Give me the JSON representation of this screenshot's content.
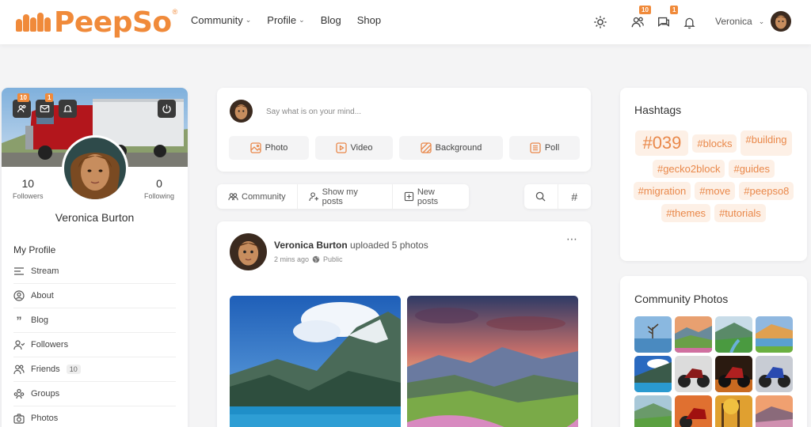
{
  "brand": {
    "name": "PeepSo",
    "reg": "®",
    "color": "#f08a3a"
  },
  "nav": [
    {
      "label": "Community",
      "chevron": true
    },
    {
      "label": "Profile",
      "chevron": true
    },
    {
      "label": "Blog",
      "chevron": false
    },
    {
      "label": "Shop",
      "chevron": false
    }
  ],
  "header": {
    "friends_badge": "10",
    "messages_badge": "1",
    "username": "Veronica"
  },
  "profile": {
    "cover_friends_badge": "10",
    "cover_messages_badge": "1",
    "followers_count": "10",
    "followers_label": "Followers",
    "following_count": "0",
    "following_label": "Following",
    "name": "Veronica Burton",
    "section_title": "My Profile",
    "menu": [
      {
        "label": "Stream",
        "icon": "stream-icon"
      },
      {
        "label": "About",
        "icon": "user-circle-icon"
      },
      {
        "label": "Blog",
        "icon": "quote-icon"
      },
      {
        "label": "Followers",
        "icon": "followers-icon"
      },
      {
        "label": "Friends",
        "icon": "friends-icon",
        "count": "10"
      },
      {
        "label": "Groups",
        "icon": "groups-icon"
      },
      {
        "label": "Photos",
        "icon": "camera-icon"
      }
    ]
  },
  "postbox": {
    "placeholder": "Say what is on your mind...",
    "actions": [
      {
        "label": "Photo",
        "icon": "photo-icon"
      },
      {
        "label": "Video",
        "icon": "video-icon"
      },
      {
        "label": "Background",
        "icon": "background-icon"
      },
      {
        "label": "Poll",
        "icon": "poll-icon"
      }
    ]
  },
  "filters": [
    {
      "label": "Community",
      "icon": "community-icon"
    },
    {
      "label": "Show my posts",
      "icon": "user-filter-icon"
    },
    {
      "label": "New posts",
      "icon": "new-posts-icon"
    }
  ],
  "feed": {
    "author": "Veronica Burton",
    "action": "uploaded 5 photos",
    "time": "2 mins ago",
    "privacy": "Public"
  },
  "hashtags": {
    "title": "Hashtags",
    "items": [
      "#039",
      "#blocks",
      "#building",
      "#gecko2block",
      "#guides",
      "#migration",
      "#move",
      "#peepso8",
      "#themes",
      "#tutorials"
    ]
  },
  "community_photos": {
    "title": "Community Photos"
  },
  "accent": "#f08a3a"
}
